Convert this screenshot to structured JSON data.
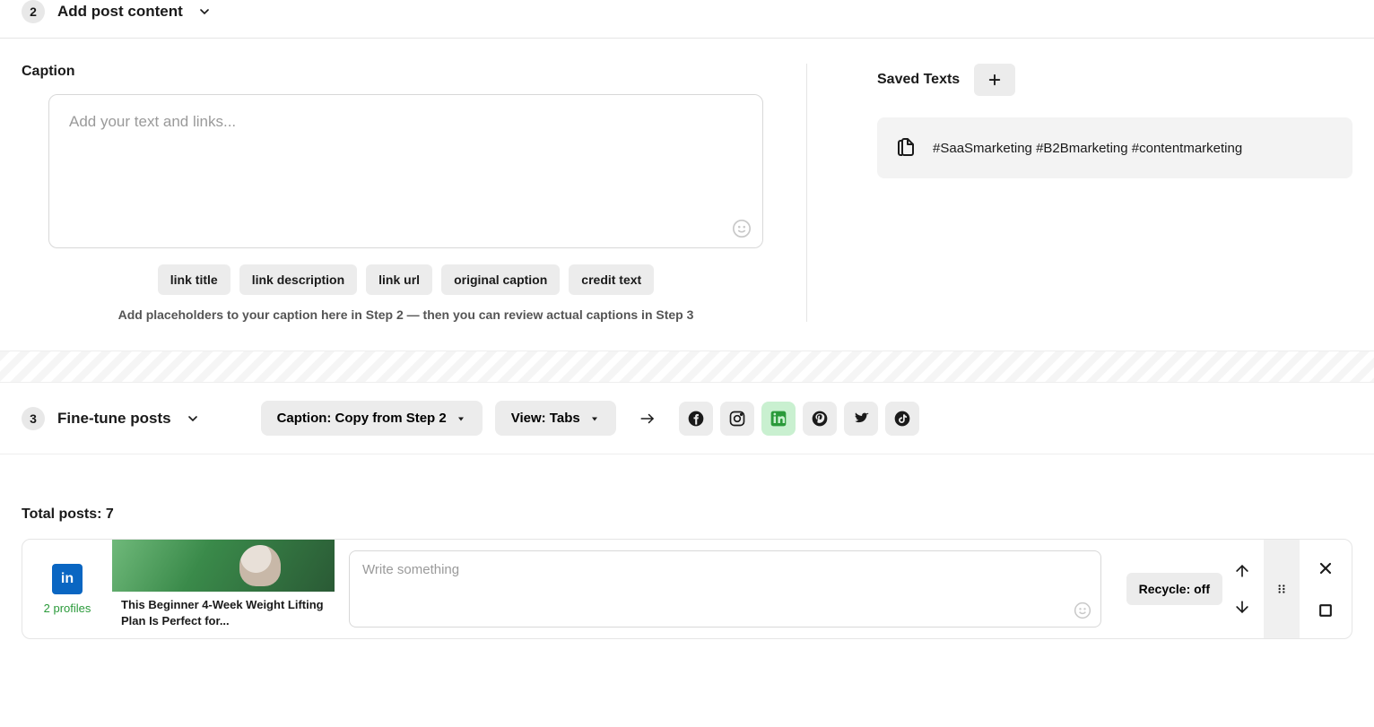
{
  "step2": {
    "number": "2",
    "title": "Add post content",
    "captionLabel": "Caption",
    "captionPlaceholder": "Add your text and links...",
    "placeholders": {
      "link_title": "link title",
      "link_description": "link description",
      "link_url": "link url",
      "original_caption": "original caption",
      "credit_text": "credit text"
    },
    "placeholderHint": "Add placeholders to your caption here in Step 2 — then you can review actual captions in Step 3",
    "savedTextsLabel": "Saved Texts",
    "savedItems": [
      {
        "text": "#SaaSmarketing #B2Bmarketing #contentmarketing"
      }
    ]
  },
  "step3": {
    "number": "3",
    "title": "Fine-tune posts",
    "captionDropdown": "Caption: Copy from Step 2",
    "viewDropdown": "View: Tabs",
    "totalPostsLabel": "Total posts: 7",
    "post": {
      "profileCount": "2 profiles",
      "previewTitle": "This Beginner 4-Week Weight Lifting Plan Is Perfect for...",
      "textPlaceholder": "Write something",
      "recycleLabel": "Recycle: off"
    }
  }
}
